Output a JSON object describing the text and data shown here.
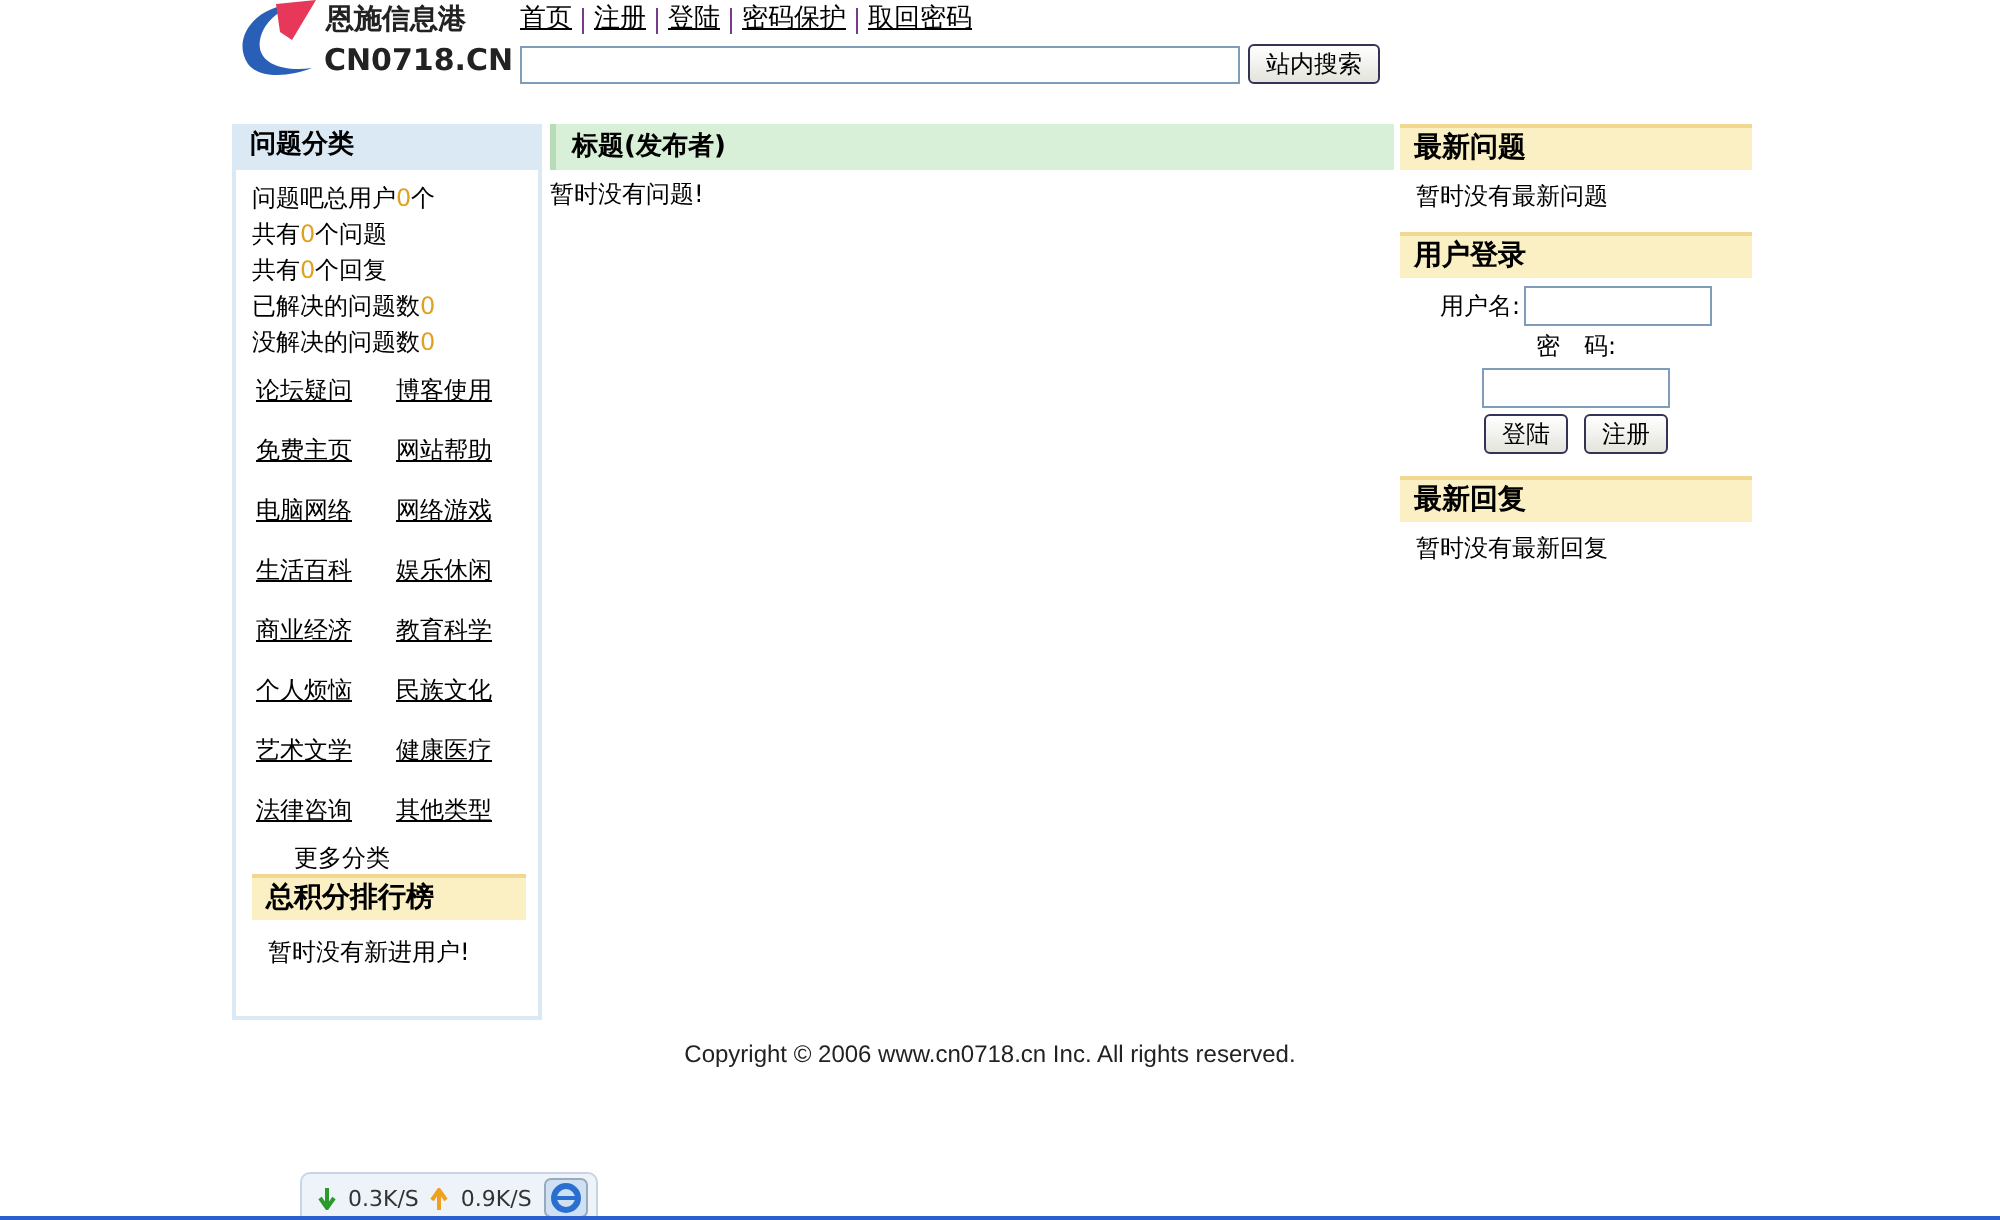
{
  "header": {
    "logo_cn": "恩施信息港",
    "logo_en": "CN0718.CN",
    "nav": [
      "首页",
      "注册",
      "登陆",
      "密码保护",
      "取回密码"
    ],
    "search_button": "站内搜索"
  },
  "left": {
    "title": "问题分类",
    "stats": [
      {
        "label": "问题吧总用户",
        "count": "0",
        "suffix": "个"
      },
      {
        "label": "共有",
        "count": "0",
        "suffix": "个问题"
      },
      {
        "label": "共有",
        "count": "0",
        "suffix": "个回复"
      },
      {
        "label": "已解决的问题数",
        "count": "0"
      },
      {
        "label": "没解决的问题数",
        "count": "0"
      }
    ],
    "categories": [
      "论坛疑问",
      "博客使用",
      "免费主页",
      "网站帮助",
      "电脑网络",
      "网络游戏",
      "生活百科",
      "娱乐休闲",
      "商业经济",
      "教育科学",
      "个人烦恼",
      "民族文化",
      "艺术文学",
      "健康医疗",
      "法律咨询",
      "其他类型"
    ],
    "more": "更多分类",
    "ranking_title": "总积分排行榜",
    "ranking_empty": "暂时没有新进用户!"
  },
  "main": {
    "column_header": "标题(发布者)",
    "empty": "暂时没有问题!"
  },
  "right": {
    "latest_title": "最新问题",
    "latest_empty": "暂时没有最新问题",
    "login_title": "用户登录",
    "username_label": "用户名:",
    "password_label": "密　码:",
    "login_button": "登陆",
    "register_button": "注册",
    "replies_title": "最新回复",
    "replies_empty": "暂时没有最新回复"
  },
  "footer": "Copyright © 2006 www.cn0718.cn Inc. All rights reserved.",
  "speed_widget": {
    "down": "0.3K/S",
    "up": "0.9K/S"
  }
}
